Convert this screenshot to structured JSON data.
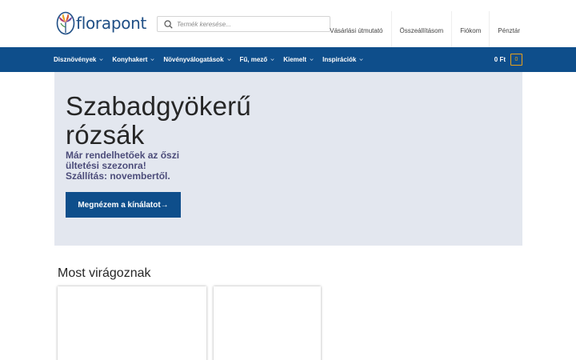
{
  "header": {
    "logo_text": "florapont",
    "search": {
      "placeholder": "Termék keresése..."
    },
    "top_links": [
      "Vásárlási útmutató",
      "Összeállításom",
      "Fiókom",
      "Pénztár"
    ]
  },
  "nav": {
    "items": [
      "Disznövények",
      "Konyhakert",
      "Növényválogatások",
      "Fű, mező",
      "Kiemelt",
      "Inspirációk"
    ],
    "cart_amount": "0 Ft",
    "cart_count": "0"
  },
  "hero": {
    "title": "Szabadgyökerű rózsák",
    "subtitle_line1": "Már rendelhetőek az őszi",
    "subtitle_line2": "ültetési szezonra!",
    "subtitle_line3": "Szállítás: novembertől.",
    "button_label": "Megnézem a kínálatot→"
  },
  "section": {
    "title": "Most virágoznak"
  },
  "colors": {
    "brand": "#0e4e8b",
    "accent": "#e8a21a",
    "hero_bg": "#e3e7ef"
  },
  "icons": {
    "search": "search-icon",
    "chevron": "chevron-down-icon",
    "logo": "flower-logo-icon"
  }
}
